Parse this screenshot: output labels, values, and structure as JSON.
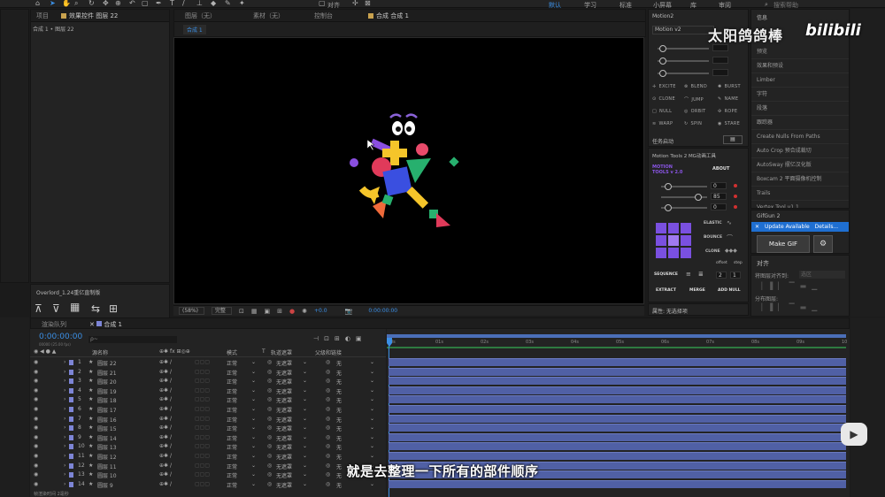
{
  "toolbar": {
    "align_label": "对齐",
    "workspaces": [
      "默认",
      "学习",
      "标准",
      "小屏幕",
      "库",
      "审阅"
    ],
    "active_workspace": "默认",
    "search_placeholder": "搜索帮助"
  },
  "project_panel": {
    "tabs": [
      "项目",
      "效果控件 图层 22"
    ],
    "breadcrumb": "合成 1 • 图层 22"
  },
  "comp_panel": {
    "tabs": [
      "图层（无）",
      "素材（无）",
      "控制台",
      "合成 合成 1"
    ],
    "sub_tab": "合成 1",
    "zoom": "(58%)",
    "quality": "完整",
    "exposure": "+0.0",
    "timecode": "0:00:00:00"
  },
  "overlord": {
    "title": "Overlord_1.24重亿直制版"
  },
  "motion2": {
    "title": "Motion2",
    "version_select": "Motion v2",
    "buttons": [
      "EXCITE",
      "BLEND",
      "BURST",
      "CLONE",
      "JUMP",
      "NAME",
      "NULL",
      "ORBIT",
      "ROPE",
      "WARP",
      "SPIN",
      "STARE"
    ],
    "task_label": "任务启动"
  },
  "motion_tools": {
    "title": "Motion Tools 2 MG动画工具",
    "logo_line1": "MOTION",
    "logo_line2": "TOOLS v 2.0",
    "about": "ABOUT",
    "values": [
      "0",
      "85",
      "0"
    ],
    "elastic": "ELASTIC",
    "bounce": "BOUNCE",
    "clone": "CLONE",
    "offset": "offset",
    "step": "step",
    "sequence": "SEQUENCE",
    "seq_values": [
      "2",
      "1"
    ],
    "extract": "EXTRACT",
    "merge": "MERGE",
    "add_null": "ADD NULL"
  },
  "properties": {
    "label": "属性: 无选择项"
  },
  "info_panel": {
    "title": "信息",
    "items": [
      "预览",
      "效果和预设",
      "Limber",
      "字符",
      "段落",
      "跟踪器",
      "Create Nulls From Paths",
      "Auto Crop 预合成裁切",
      "AutoSway 摆亿汉化版",
      "Boxcam 2 平面摄像机控制",
      "Trails",
      "Vertex Tool v1.1"
    ]
  },
  "gifgun": {
    "title": "GifGun 2",
    "update": "Update Available",
    "details": "Details...",
    "make_gif": "Make GIF"
  },
  "align_panel": {
    "title": "对齐",
    "align_to": "将图层对齐到:",
    "align_to_value": "选区",
    "distribute": "分布图层:"
  },
  "timeline": {
    "tabs": [
      "渲染队列",
      "合成 1"
    ],
    "timecode": "0:00:00:00",
    "timecode_sub": "00000 (25.00 fps)",
    "search_placeholder": "ρ~",
    "headers": [
      "源名称",
      "模式",
      "T",
      "轨道遮罩",
      "父级和链接"
    ],
    "ruler": [
      "0s",
      "01s",
      "02s",
      "03s",
      "04s",
      "05s",
      "06s",
      "07s",
      "08s",
      "09s",
      "10"
    ],
    "layers": [
      {
        "num": "1",
        "name": "圆层 22",
        "mode": "正常",
        "matte": "无遮罩",
        "parent": "无"
      },
      {
        "num": "2",
        "name": "圆层 21",
        "mode": "正常",
        "matte": "无遮罩",
        "parent": "无"
      },
      {
        "num": "3",
        "name": "圆层 20",
        "mode": "正常",
        "matte": "无遮罩",
        "parent": "无"
      },
      {
        "num": "4",
        "name": "圆层 19",
        "mode": "正常",
        "matte": "无遮罩",
        "parent": "无"
      },
      {
        "num": "5",
        "name": "圆层 18",
        "mode": "正常",
        "matte": "无遮罩",
        "parent": "无"
      },
      {
        "num": "6",
        "name": "圆层 17",
        "mode": "正常",
        "matte": "无遮罩",
        "parent": "无"
      },
      {
        "num": "7",
        "name": "圆层 16",
        "mode": "正常",
        "matte": "无遮罩",
        "parent": "无"
      },
      {
        "num": "8",
        "name": "圆层 15",
        "mode": "正常",
        "matte": "无遮罩",
        "parent": "无"
      },
      {
        "num": "9",
        "name": "圆层 14",
        "mode": "正常",
        "matte": "无遮罩",
        "parent": "无"
      },
      {
        "num": "10",
        "name": "圆层 13",
        "mode": "正常",
        "matte": "无遮罩",
        "parent": "无"
      },
      {
        "num": "11",
        "name": "圆层 12",
        "mode": "正常",
        "matte": "无遮罩",
        "parent": "无"
      },
      {
        "num": "12",
        "name": "圆层 11",
        "mode": "正常",
        "matte": "无遮罩",
        "parent": "无"
      },
      {
        "num": "13",
        "name": "圆层 10",
        "mode": "正常",
        "matte": "无遮罩",
        "parent": "无"
      },
      {
        "num": "14",
        "name": "圆层 9",
        "mode": "正常",
        "matte": "无遮罩",
        "parent": "无"
      }
    ],
    "footer": "帧渲染时间 2毫秒"
  },
  "overlay": {
    "subtitle": "就是去整理一下所有的部件顺序",
    "watermark": "太阳鸽鸽棒",
    "logo": "bilibili"
  },
  "colors": {
    "accent_blue": "#3b8fe5",
    "layer_bar": "#5060a5",
    "label_purple": "#7d85d6",
    "gifgun_update": "#1f6fd1"
  }
}
